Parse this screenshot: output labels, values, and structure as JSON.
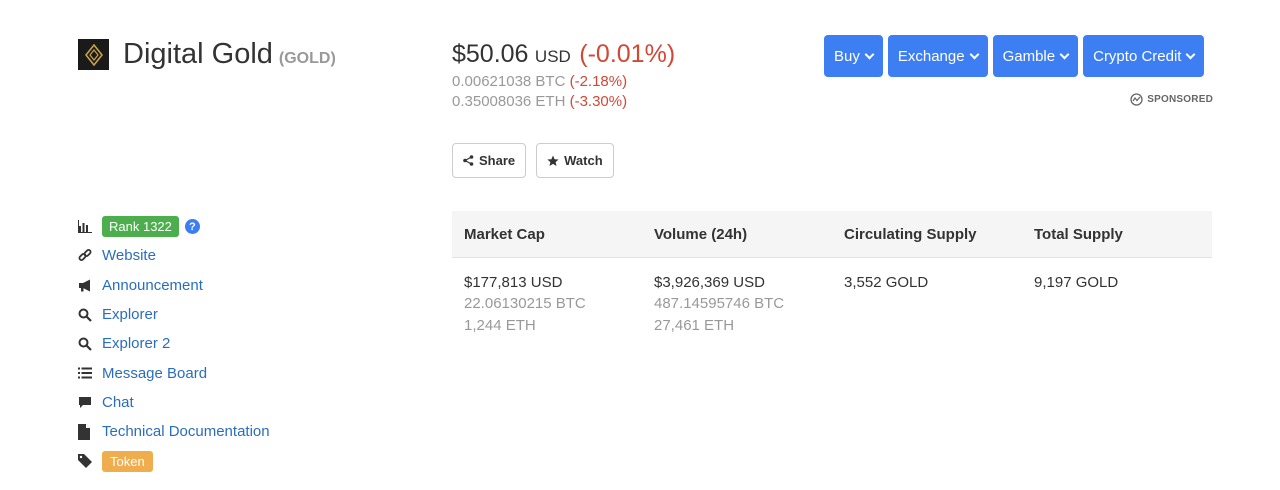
{
  "coin": {
    "name": "Digital Gold",
    "symbol": "(GOLD)",
    "price": "$50.06",
    "currency": "USD",
    "change": "(-0.01%)",
    "btc_price": "0.00621038 BTC",
    "btc_change": "(-2.18%)",
    "eth_price": "0.35008036 ETH",
    "eth_change": "(-3.30%)"
  },
  "actions": {
    "share": "Share",
    "watch": "Watch"
  },
  "top_buttons": {
    "buy": "Buy",
    "exchange": "Exchange",
    "gamble": "Gamble",
    "crypto_credit": "Crypto Credit"
  },
  "sponsored": "SPONSORED",
  "sidebar": {
    "rank": "Rank 1322",
    "website": "Website",
    "announcement": "Announcement",
    "explorer": "Explorer",
    "explorer2": "Explorer 2",
    "message_board": "Message Board",
    "chat": "Chat",
    "tech_doc": "Technical Documentation",
    "token": "Token"
  },
  "stats": {
    "headers": [
      "Market Cap",
      "Volume (24h)",
      "Circulating Supply",
      "Total Supply"
    ],
    "market_cap": {
      "usd": "$177,813 USD",
      "btc": "22.06130215 BTC",
      "eth": "1,244 ETH"
    },
    "volume": {
      "usd": "$3,926,369 USD",
      "btc": "487.14595746 BTC",
      "eth": "27,461 ETH"
    },
    "circulating": "3,552 GOLD",
    "total": "9,197 GOLD"
  },
  "colors": {
    "accent": "#3d7ef2",
    "negative": "#d14836",
    "rank": "#4cae4c",
    "token": "#f0ad4e",
    "link": "#2a6ebb"
  }
}
